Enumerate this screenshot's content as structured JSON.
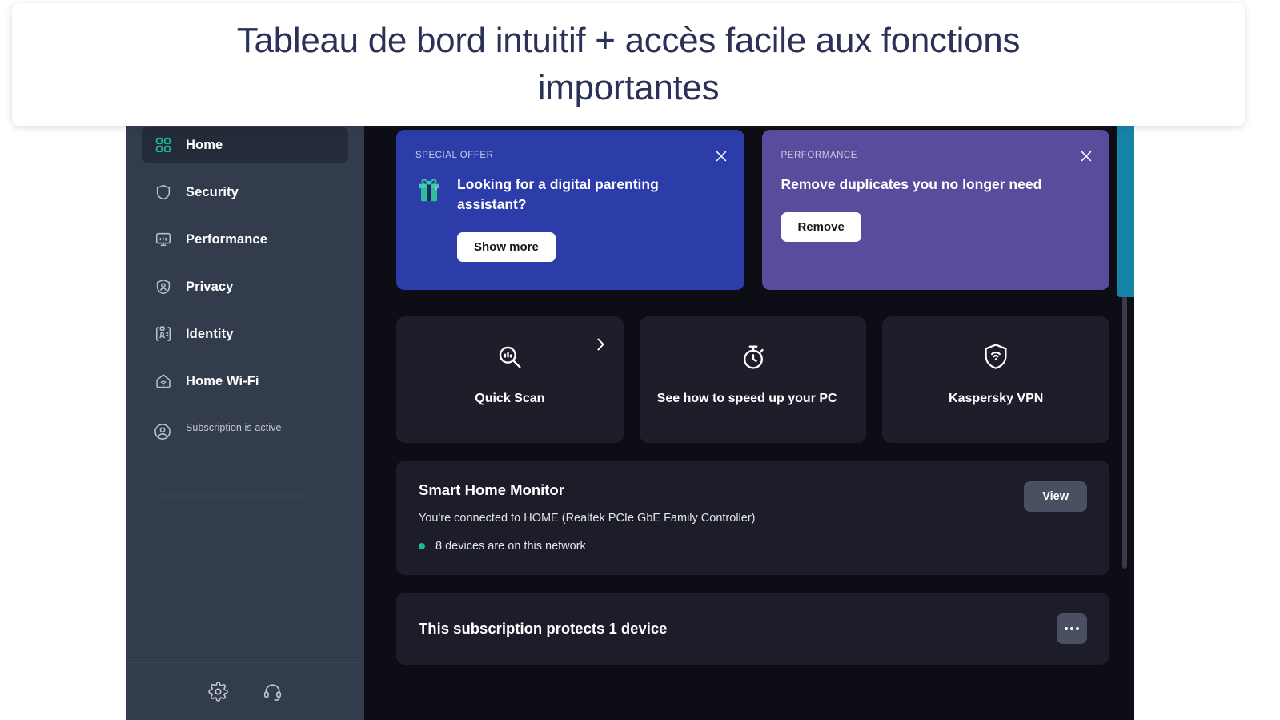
{
  "headline": {
    "text": "Tableau de bord intuitif + accès facile aux fonctions importantes",
    "color": "#2b3157"
  },
  "sidebar": {
    "items": [
      {
        "label": "Home",
        "icon": "grid-icon",
        "active": true
      },
      {
        "label": "Security",
        "icon": "shield-icon",
        "active": false
      },
      {
        "label": "Performance",
        "icon": "monitor-icon",
        "active": false
      },
      {
        "label": "Privacy",
        "icon": "privacy-shield-icon",
        "active": false
      },
      {
        "label": "Identity",
        "icon": "id-card-icon",
        "active": false
      },
      {
        "label": "Home Wi-Fi",
        "icon": "home-wifi-icon",
        "active": false
      }
    ],
    "account": {
      "icon": "account-icon",
      "name_redacted": "",
      "status": "Subscription is active"
    },
    "footer": {
      "settings_icon": "gear-icon",
      "support_icon": "headset-icon"
    },
    "active_bg": "#232b38",
    "bg": "#333c4c"
  },
  "banners": [
    {
      "kicker": "SPECIAL OFFER",
      "title": "Looking for a digital parenting assistant?",
      "button": "Show more",
      "icon": "gift-icon",
      "close_icon": "close-icon",
      "bg": "#2c3ca8"
    },
    {
      "kicker": "PERFORMANCE",
      "title": "Remove duplicates you no longer need",
      "button": "Remove",
      "close_icon": "close-icon",
      "bg": "#5a4c9c"
    }
  ],
  "tiles": [
    {
      "label": "Quick Scan",
      "icon": "quick-scan-icon",
      "chevron": "chevron-right-icon"
    },
    {
      "label": "See how to speed up your PC",
      "icon": "stopwatch-icon"
    },
    {
      "label": "Kaspersky VPN",
      "icon": "vpn-shield-icon"
    }
  ],
  "smart_home": {
    "title": "Smart Home Monitor",
    "subtitle": "You're connected to HOME (Realtek PCIe GbE Family Controller)",
    "status": "8 devices are on this network",
    "status_color": "#19b99a",
    "button": "View"
  },
  "subscription_panel": {
    "title": "This subscription protects 1 device",
    "more_label": "More options"
  },
  "accent": {
    "teal": "#1583a8",
    "green": "#19b99a"
  }
}
